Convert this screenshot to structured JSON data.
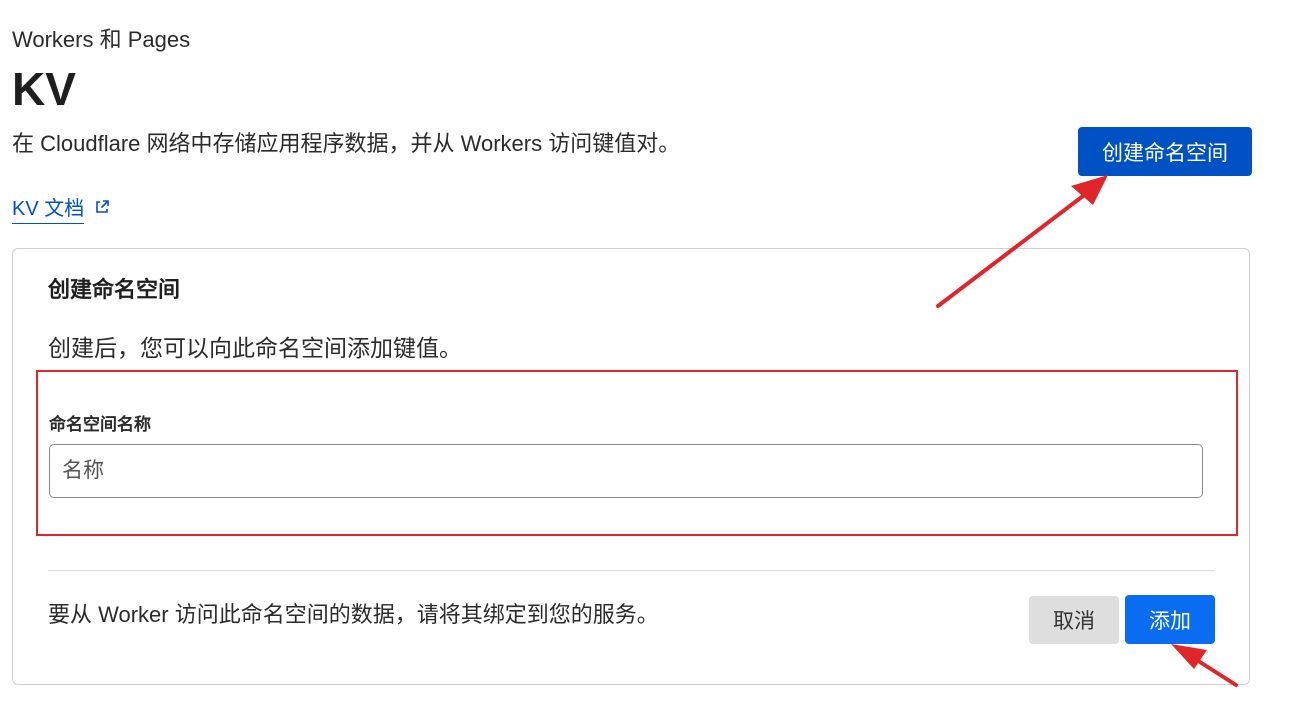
{
  "header": {
    "breadcrumb": "Workers 和 Pages",
    "title": "KV",
    "description": "在 Cloudflare 网络中存储应用程序数据，并从 Workers 访问键值对。",
    "create_button_label": "创建命名空间",
    "docs_link_label": "KV 文档"
  },
  "create_panel": {
    "title": "创建命名空间",
    "description": "创建后，您可以向此命名空间添加键值。",
    "field_label": "命名空间名称",
    "input_placeholder": "名称",
    "input_value": "",
    "footer_note": "要从 Worker 访问此命名空间的数据，请将其绑定到您的服务。",
    "cancel_label": "取消",
    "add_label": "添加"
  },
  "icons": {
    "docs_link": "external-link-icon"
  },
  "colors": {
    "primary_button": "#0051c3",
    "add_button": "#0a6cf0",
    "cancel_button": "#dedede",
    "annotation": "#e0252b",
    "link": "#0051c3"
  }
}
